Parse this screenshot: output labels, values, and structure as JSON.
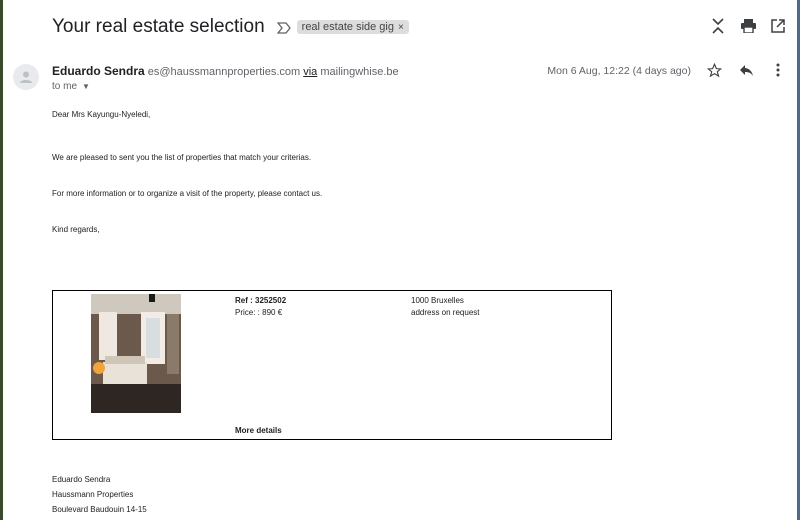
{
  "email": {
    "subject": "Your real estate selection",
    "label": "real estate side gig",
    "label_remove": "×",
    "sender_name": "Eduardo Sendra",
    "sender_email": "es@haussmannproperties.com",
    "via_label": "via",
    "via_domain": "mailingwhise.be",
    "to_label": "to me",
    "date": "Mon 6 Aug, 12:22 (4 days ago)"
  },
  "icons": {
    "expand": "unfold-icon",
    "print": "print-icon",
    "open_new": "open-in-new-icon",
    "star": "star-icon",
    "reply": "reply-icon",
    "more": "more-vert-icon",
    "important": "important-marker-icon",
    "avatar": "person-icon"
  },
  "body": {
    "greeting": "Dear Mrs Kayungu-Nyeledi,",
    "line1": "We are pleased to sent you the list of properties that match your criterias.",
    "line2": "For more information or to organize a visit of the property, please contact us.",
    "closing": "Kind regards,"
  },
  "property": {
    "ref": "Ref : 3252502",
    "price": "Price: : 890 €",
    "city": "1000 Bruxelles",
    "address": "address on request",
    "more_details": "More details"
  },
  "signature": {
    "name": "Eduardo Sendra",
    "company": "Haussmann Properties",
    "street": "Boulevard Baudouin 14-15"
  }
}
